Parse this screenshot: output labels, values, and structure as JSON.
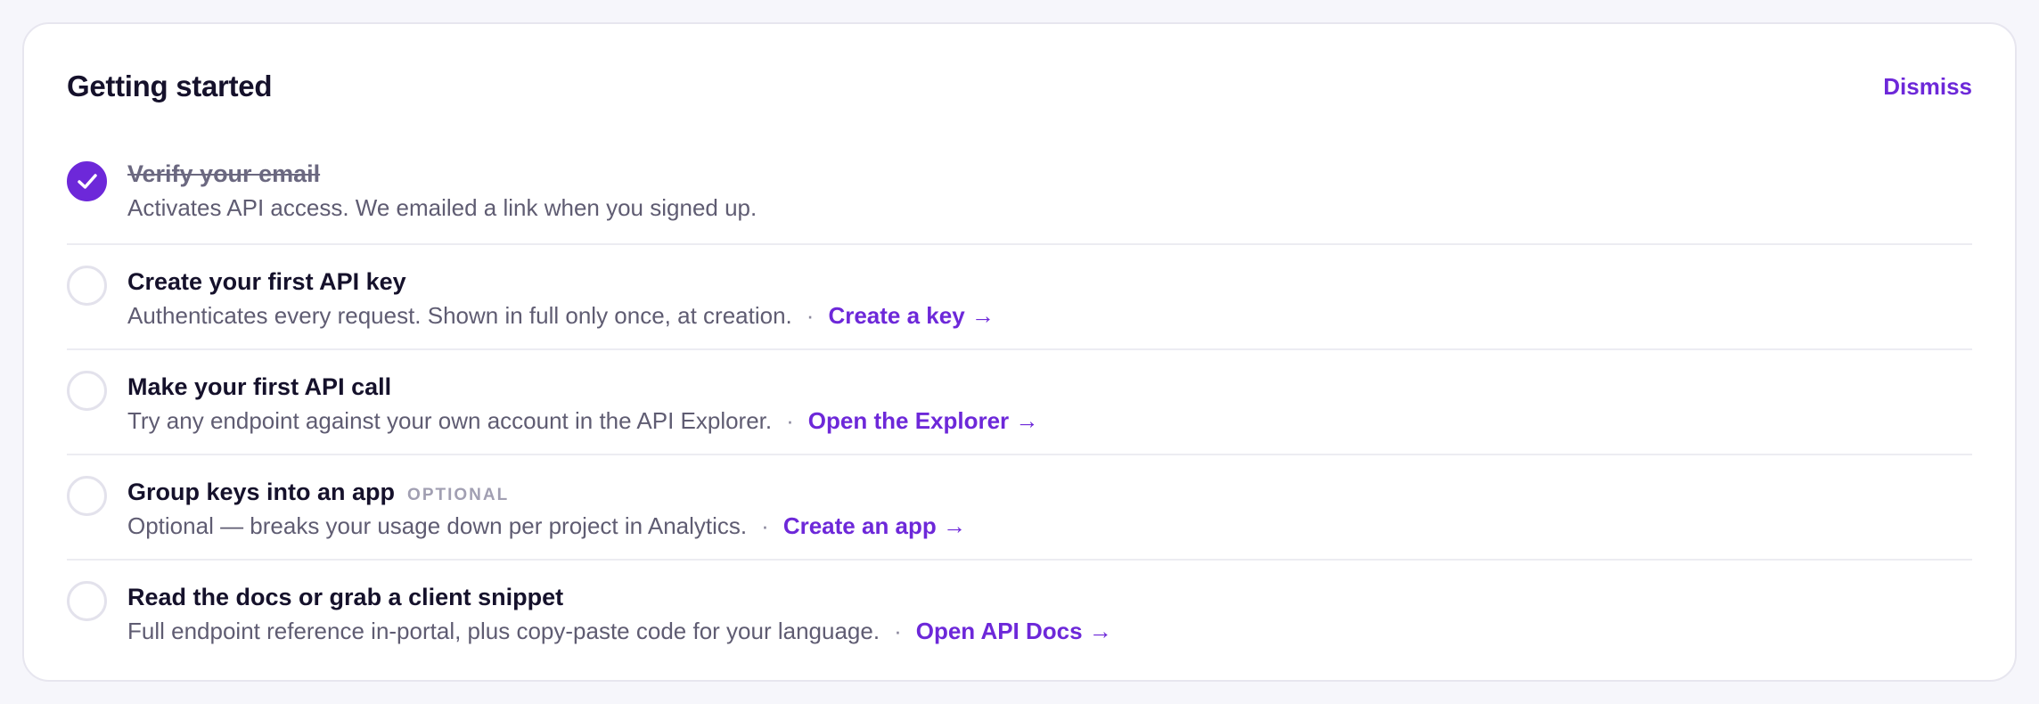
{
  "header": {
    "title": "Getting started",
    "dismiss_label": "Dismiss"
  },
  "steps": [
    {
      "title": "Verify your email",
      "completed": true,
      "description": "Activates API access. We emailed a link when you signed up."
    },
    {
      "title": "Create your first API key",
      "completed": false,
      "description": "Authenticates every request. Shown in full only once, at creation.",
      "separator": "·",
      "link": "Create a key →"
    },
    {
      "title": "Make your first API call",
      "completed": false,
      "description": "Try any endpoint against your own account in the API Explorer.",
      "separator": "·",
      "link": "Open the Explorer →"
    },
    {
      "title": "Group keys into an app",
      "completed": false,
      "tag": "OPTIONAL",
      "description": "Optional — breaks your usage down per project in Analytics.",
      "separator": "·",
      "link": "Create an app →"
    },
    {
      "title": "Read the docs or grab a client snippet",
      "completed": false,
      "description": "Full endpoint reference in-portal, plus copy-paste code for your language.",
      "separator": "·",
      "link": "Open API Docs →"
    }
  ],
  "colors": {
    "accent": "#6d28d9",
    "background": "#f6f6fb",
    "card": "#ffffff"
  },
  "icons": {
    "completed": "checkmark-icon",
    "pending": "empty-circle-icon"
  }
}
